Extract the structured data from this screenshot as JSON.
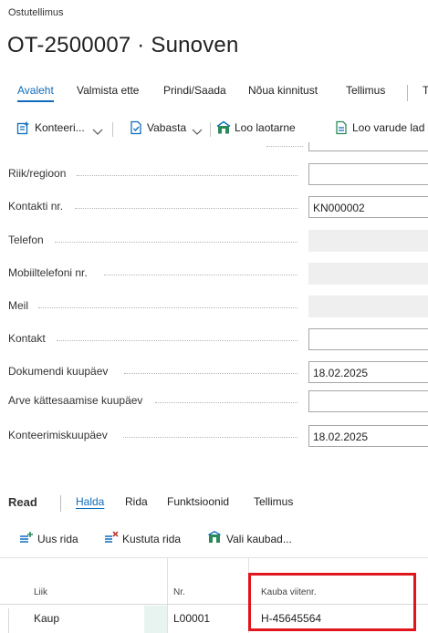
{
  "page": {
    "caption": "Ostutellimus",
    "title": "OT-2500007 · Sunoven"
  },
  "action_tabs": [
    "Avaleht",
    "Valmista ette",
    "Prindi/Saada",
    "Nõua kinnitust",
    "Tellimus",
    "T"
  ],
  "toolbar": {
    "post_label": "Konteeri...",
    "release_label": "Vabasta",
    "create_whse_receipt_label": "Loo laotarne",
    "create_inventory_put_away_label": "Loo varude lad"
  },
  "fields": [
    {
      "label": "Riik/regioon",
      "value": ""
    },
    {
      "label": "Kontakti nr.",
      "value": "KN000002"
    },
    {
      "label": "Telefon",
      "value": ""
    },
    {
      "label": "Mobiiltelefoni nr.",
      "value": ""
    },
    {
      "label": "Meil",
      "value": ""
    },
    {
      "label": "Kontakt",
      "value": ""
    },
    {
      "label": "Dokumendi kuupäev",
      "value": "18.02.2025"
    },
    {
      "label": "Arve kättesaamise kuupäev",
      "value": ""
    },
    {
      "label": "Konteerimiskuupäev",
      "value": "18.02.2025"
    }
  ],
  "lines": {
    "title": "Read",
    "tabs": [
      "Halda",
      "Rida",
      "Funktsioonid",
      "Tellimus"
    ],
    "actions": {
      "new_line": "Uus rida",
      "delete_line": "Kustuta rida",
      "select_items": "Vali kaubad..."
    },
    "columns": [
      "Liik",
      "Nr.",
      "Kauba viitenr."
    ],
    "rows": [
      {
        "type": "Kaup",
        "no": "L00001",
        "item_reference": "H-45645564"
      }
    ]
  },
  "colors": {
    "accent": "#0f6cbd",
    "highlight_box": "#e0161e"
  }
}
